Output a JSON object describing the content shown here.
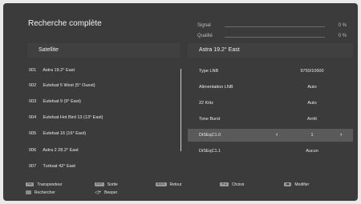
{
  "screen": {
    "title": "Recherche complète"
  },
  "signal": {
    "label": "Signal",
    "value": "0 %"
  },
  "quality": {
    "label": "Qualité",
    "value": "0 %"
  },
  "left_header": "Satellite",
  "right_header": "Astra 19.2° East",
  "satellites": [
    {
      "num": "001",
      "name": "Astra 19.2° East"
    },
    {
      "num": "002",
      "name": "Eutelsat 5 West (5° Ouest)"
    },
    {
      "num": "003",
      "name": "Eutelsat 9 (9° East)"
    },
    {
      "num": "004",
      "name": "Eutelsat Hot Bird 13 (13° East)"
    },
    {
      "num": "005",
      "name": "Eutelsat 16 (16° East)"
    },
    {
      "num": "006",
      "name": "Astra 2 28.2° East"
    },
    {
      "num": "007",
      "name": "Turksat 42° East"
    }
  ],
  "params": [
    {
      "label": "Type LNB",
      "value": "9750/10600"
    },
    {
      "label": "Alimentation LNB",
      "value": "Auto"
    },
    {
      "label": "22 KHz",
      "value": "Auto"
    },
    {
      "label": "Tone Burst",
      "value": "Arrêt"
    },
    {
      "label": "DiSEqC1.0",
      "value": "1"
    },
    {
      "label": "DiSEqC1.1",
      "value": "Aucun"
    }
  ],
  "footer": {
    "fav_chip": "FAV",
    "fav_label": "Transpondeur",
    "exit_chip": "EXIT",
    "exit_label": "Sortie",
    "back_chip": "BACK",
    "back_label": "Retour",
    "choose_chip": "▼▲",
    "choose_label": "Choisir",
    "modify_chip": "◀▶",
    "modify_label": "Modifier",
    "search_label": "Rechercher",
    "beeper_label": "Beeper"
  },
  "colors": {
    "background": "#3b3b3b",
    "selected_row": "#5a5a5a",
    "header_bar": "#404040"
  }
}
